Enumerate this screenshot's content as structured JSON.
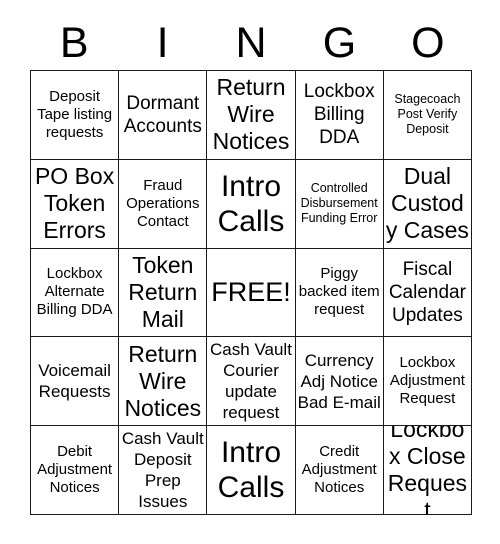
{
  "header": {
    "letters": [
      "B",
      "I",
      "N",
      "G",
      "O"
    ]
  },
  "card": {
    "free_space_label": "FREE!",
    "rows": [
      [
        "Deposit Tape listing requests",
        "Dormant Accounts",
        "Return Wire Notices",
        "Lockbox Billing DDA",
        "Stagecoach Post Verify Deposit"
      ],
      [
        "PO Box Token Errors",
        "Fraud Operations Contact",
        "Intro Calls",
        "Controlled Disbursement Funding Error",
        "Dual Custody Cases"
      ],
      [
        "Lockbox Alternate Billing DDA",
        "Token Return Mail",
        "FREE!",
        "Piggy backed item request",
        "Fiscal Calendar Updates"
      ],
      [
        "Voicemail Requests",
        "Return Wire Notices",
        "Cash Vault Courier update request",
        "Currency Adj Notice Bad E-mail",
        "Lockbox Adjustment Request"
      ],
      [
        "Debit Adjustment Notices",
        "Cash Vault Deposit Prep Issues",
        "Intro Calls",
        "Credit Adjustment Notices",
        "Lockbox Close Request"
      ]
    ]
  },
  "style": {
    "background_color": "#ffffff",
    "border_color": "#1a1a1a",
    "text_color": "#000000"
  }
}
